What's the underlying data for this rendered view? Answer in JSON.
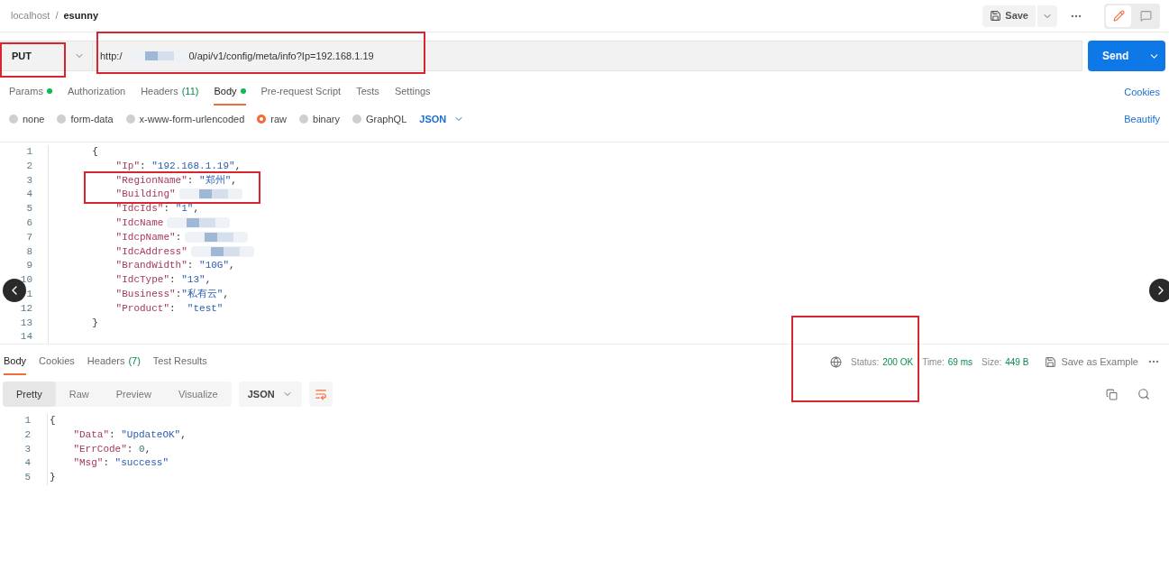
{
  "breadcrumb": {
    "workspace": "localhost",
    "separator": "/",
    "request": "esunny"
  },
  "toolbar": {
    "save": "Save"
  },
  "view_toggle": [
    {
      "kind": "edit",
      "selected": true
    },
    {
      "kind": "comments",
      "selected": false
    }
  ],
  "request": {
    "method": "PUT",
    "url_prefix": "http:/",
    "url_suffix": "0/api/v1/config/meta/info?Ip=192.168.1.19",
    "send": "Send"
  },
  "request_tabs": [
    {
      "label": "Params",
      "dot": true,
      "selected": false
    },
    {
      "label": "Authorization",
      "dot": false,
      "selected": false
    },
    {
      "label": "Headers",
      "count": "(11)",
      "dot": false,
      "selected": false
    },
    {
      "label": "Body",
      "dot": true,
      "selected": true
    },
    {
      "label": "Pre-request Script",
      "dot": false,
      "selected": false
    },
    {
      "label": "Tests",
      "dot": false,
      "selected": false
    },
    {
      "label": "Settings",
      "dot": false,
      "selected": false
    }
  ],
  "cookies_link": "Cookies",
  "body_types": [
    {
      "label": "none",
      "selected": false
    },
    {
      "label": "form-data",
      "selected": false
    },
    {
      "label": "x-www-form-urlencoded",
      "selected": false
    },
    {
      "label": "raw",
      "selected": true
    },
    {
      "label": "binary",
      "selected": false
    },
    {
      "label": "GraphQL",
      "selected": false
    }
  ],
  "body_format": "JSON",
  "beautify": "Beautify",
  "request_body": [
    {
      "number": "1",
      "tokens": [
        {
          "kind": "open",
          "text": "{"
        }
      ]
    },
    {
      "number": "2",
      "tokens": [
        {
          "kind": "key",
          "text": "\"Ip\""
        },
        {
          "kind": "punct",
          "text": ": "
        },
        {
          "kind": "string",
          "text": "\"192.168.1.19\""
        },
        {
          "kind": "punct",
          "text": ","
        }
      ]
    },
    {
      "number": "3",
      "tokens": [
        {
          "kind": "key",
          "text": "\"RegionName\""
        },
        {
          "kind": "punct",
          "text": ": "
        },
        {
          "kind": "string",
          "text": "\"郑州\""
        },
        {
          "kind": "punct",
          "text": ","
        }
      ]
    },
    {
      "number": "4",
      "tokens": [
        {
          "kind": "key",
          "text": "\"Building\""
        },
        {
          "kind": "redacted"
        }
      ]
    },
    {
      "number": "5",
      "tokens": [
        {
          "kind": "key",
          "text": "\"IdcIds\""
        },
        {
          "kind": "punct",
          "text": ": "
        },
        {
          "kind": "string",
          "text": "\"1\""
        },
        {
          "kind": "punct",
          "text": ","
        }
      ]
    },
    {
      "number": "6",
      "tokens": [
        {
          "kind": "key",
          "text": "\"IdcName"
        },
        {
          "kind": "redacted"
        }
      ]
    },
    {
      "number": "7",
      "tokens": [
        {
          "kind": "key",
          "text": "\"IdcpName\""
        },
        {
          "kind": "punct",
          "text": ":"
        },
        {
          "kind": "redacted"
        }
      ]
    },
    {
      "number": "8",
      "tokens": [
        {
          "kind": "key",
          "text": "\"IdcAddress\""
        },
        {
          "kind": "redacted"
        }
      ]
    },
    {
      "number": "9",
      "tokens": [
        {
          "kind": "key",
          "text": "\"BrandWidth\""
        },
        {
          "kind": "punct",
          "text": ": "
        },
        {
          "kind": "string",
          "text": "\"10G\""
        },
        {
          "kind": "punct",
          "text": ","
        }
      ]
    },
    {
      "number": "10",
      "tokens": [
        {
          "kind": "key",
          "text": "\"IdcType\""
        },
        {
          "kind": "punct",
          "text": ": "
        },
        {
          "kind": "string",
          "text": "\"13\""
        },
        {
          "kind": "punct",
          "text": ","
        }
      ]
    },
    {
      "number": "1",
      "tokens": [
        {
          "kind": "key",
          "text": "\"Business\""
        },
        {
          "kind": "punct",
          "text": ":"
        },
        {
          "kind": "string",
          "text": "\"私有云\""
        },
        {
          "kind": "punct",
          "text": ","
        }
      ]
    },
    {
      "number": "12",
      "tokens": [
        {
          "kind": "key",
          "text": "\"Product\""
        },
        {
          "kind": "punct",
          "text": ":  "
        },
        {
          "kind": "string",
          "text": "\"test\""
        }
      ]
    },
    {
      "number": "13",
      "tokens": [
        {
          "kind": "close",
          "text": "}"
        }
      ]
    },
    {
      "number": "14"
    }
  ],
  "response_tabs": [
    {
      "label": "Body",
      "selected": true
    },
    {
      "label": "Cookies",
      "selected": false
    },
    {
      "label": "Headers",
      "count": "(7)",
      "selected": false
    },
    {
      "label": "Test Results",
      "selected": false
    }
  ],
  "response_meta": [
    {
      "label": "Status:",
      "value": "200 OK"
    },
    {
      "label": "Time:",
      "value": "69 ms"
    },
    {
      "label": "Size:",
      "value": "449 B"
    }
  ],
  "save_example": "Save as Example",
  "view_modes": [
    {
      "label": "Pretty",
      "selected": true
    },
    {
      "label": "Raw",
      "selected": false
    },
    {
      "label": "Preview",
      "selected": false
    },
    {
      "label": "Visualize",
      "selected": false
    }
  ],
  "response_format": "JSON",
  "response_body": [
    {
      "number": "1",
      "tokens": [
        {
          "kind": "open",
          "text": "{"
        }
      ]
    },
    {
      "number": "2",
      "tokens": [
        {
          "kind": "key",
          "text": "\"Data\""
        },
        {
          "kind": "punct",
          "text": ": "
        },
        {
          "kind": "string",
          "text": "\"UpdateOK\""
        },
        {
          "kind": "punct",
          "text": ","
        }
      ]
    },
    {
      "number": "3",
      "tokens": [
        {
          "kind": "key",
          "text": "\"ErrCode\""
        },
        {
          "kind": "punct",
          "text": ": "
        },
        {
          "kind": "number",
          "text": "0"
        },
        {
          "kind": "punct",
          "text": ","
        }
      ]
    },
    {
      "number": "4",
      "tokens": [
        {
          "kind": "key",
          "text": "\"Msg\""
        },
        {
          "kind": "punct",
          "text": ": "
        },
        {
          "kind": "string",
          "text": "\"success\""
        }
      ]
    },
    {
      "number": "5",
      "tokens": [
        {
          "kind": "close",
          "text": "}"
        }
      ]
    }
  ]
}
